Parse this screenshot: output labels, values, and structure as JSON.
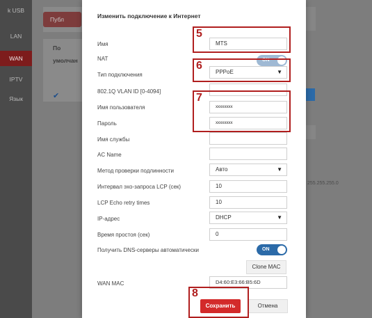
{
  "background": {
    "sidebar_items": [
      {
        "label": "k USB",
        "active": false
      },
      {
        "label": "LAN",
        "active": false
      },
      {
        "label": "WAN",
        "active": true
      },
      {
        "label": "IPTV",
        "active": false
      },
      {
        "label": "Язык",
        "active": false
      }
    ],
    "publish_label": "Публ",
    "col_header_1": "По",
    "col_header_2": "умолчан",
    "check_glyph": "✔",
    "ip_text": "255.255.255.0"
  },
  "modal": {
    "title": "Изменить подключение к Интернет",
    "rows": {
      "name_label": "Имя",
      "name_value": "MTS",
      "nat_label": "NAT",
      "nat_toggle": "ON",
      "conn_type_label": "Тип подключения",
      "conn_type_value": "PPPoE",
      "vlan_label": "802.1Q VLAN ID [0-4094]",
      "vlan_value": "",
      "username_label": "Имя пользователя",
      "username_value": "xxxxxxxx",
      "password_label": "Пароль",
      "password_value": "xxxxxxxx",
      "service_label": "Имя службы",
      "service_value": "",
      "ac_label": "AC Name",
      "ac_value": "",
      "auth_label": "Метод проверки подлинности",
      "auth_value": "Авто",
      "lcp_interval_label": "Интервал эхо-запроса LCP (сек)",
      "lcp_interval_value": "10",
      "lcp_retry_label": "LCP Echo retry times",
      "lcp_retry_value": "10",
      "ip_label": "IP-адрес",
      "ip_value": "DHCP",
      "idle_label": "Время простоя (сек)",
      "idle_value": "0",
      "dns_label": "Получить DNS-серверы автоматически",
      "dns_toggle": "ON",
      "clone_mac_label": "Clone MAC",
      "wan_mac_label": "WAN MAC",
      "wan_mac_value": "D4:60:E3:66:B5:6D"
    },
    "save_label": "Сохранить",
    "cancel_label": "Отмена"
  },
  "annotations": {
    "n5": "5",
    "n6": "6",
    "n7": "7",
    "n8": "8"
  },
  "colors": {
    "accent_red": "#d32a2a",
    "annotation_red": "#b01e1e",
    "toggle_blue": "#2b6aa8"
  }
}
